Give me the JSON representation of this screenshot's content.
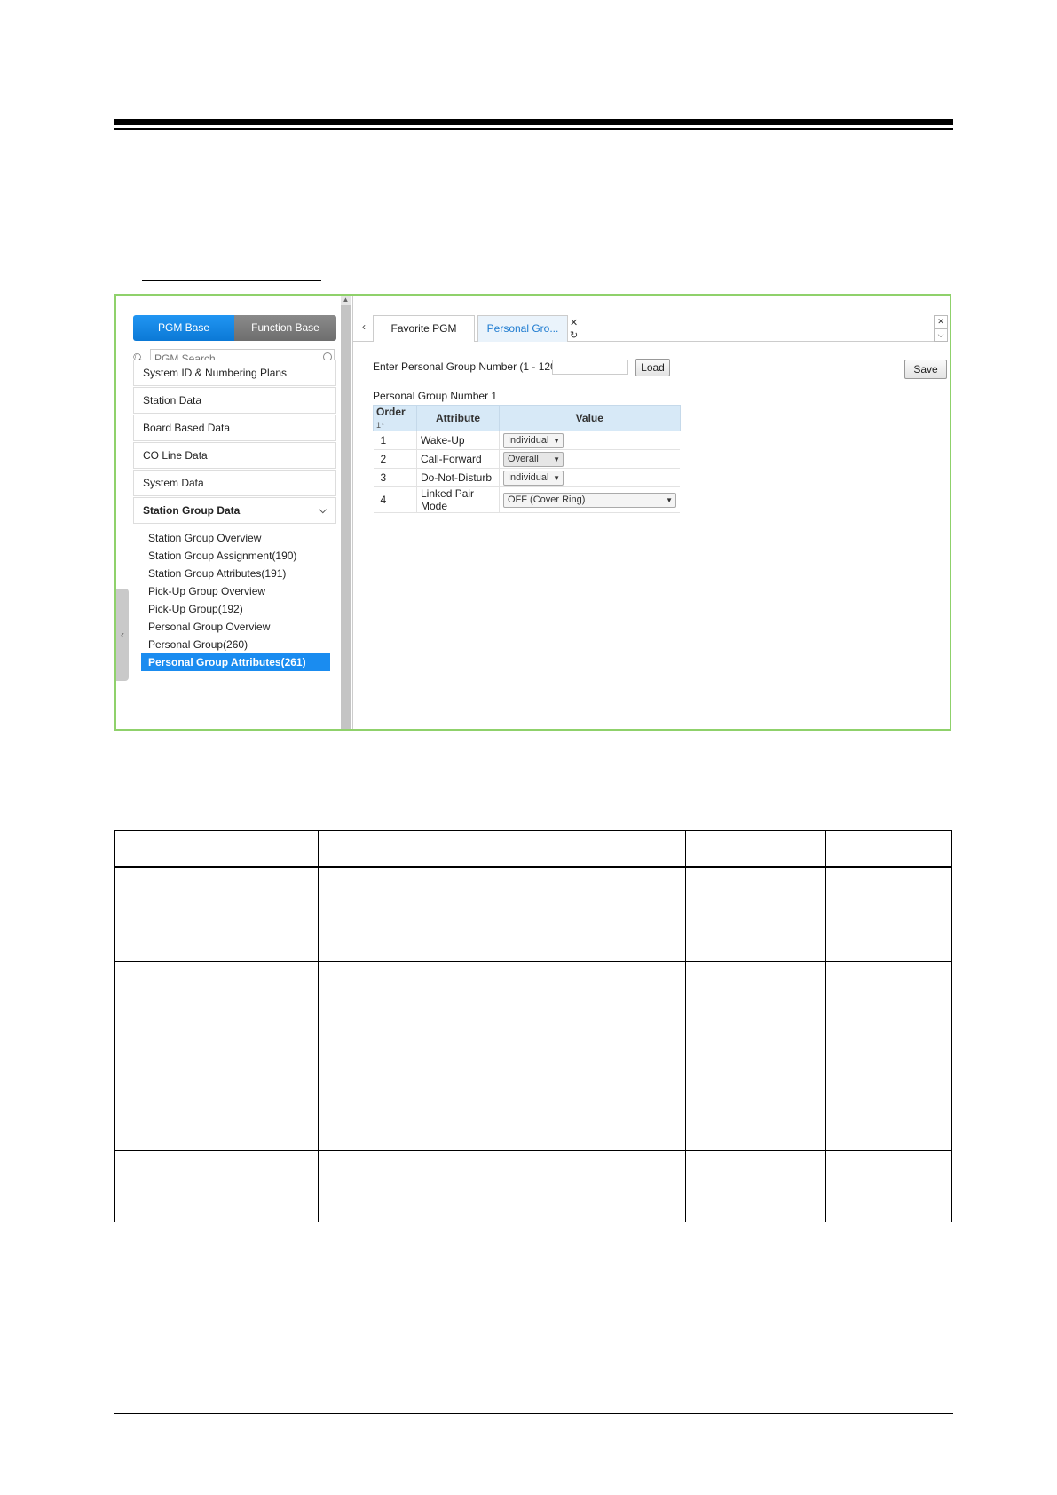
{
  "sidebar": {
    "tabs": [
      "PGM Base",
      "Function Base"
    ],
    "search_placeholder": "PGM Search",
    "items": [
      "System ID & Numbering Plans",
      "Station Data",
      "Board Based Data",
      "CO Line Data",
      "System Data",
      "Station Group Data"
    ],
    "sub_items": [
      "Station Group Overview",
      "Station Group Assignment(190)",
      "Station Group Attributes(191)",
      "Pick-Up Group Overview",
      "Pick-Up Group(192)",
      "Personal Group Overview",
      "Personal Group(260)",
      "Personal Group Attributes(261)"
    ]
  },
  "content": {
    "tabs": [
      "Favorite PGM",
      "Personal Gro..."
    ],
    "enter_label": "Enter Personal Group Number (1 - 1200) :",
    "load_label": "Load",
    "save_label": "Save",
    "group_label": "Personal Group Number 1",
    "table": {
      "headers": [
        "Order",
        "Attribute",
        "Value"
      ],
      "sort_icon": "1↑",
      "rows": [
        {
          "order": "1",
          "attribute": "Wake-Up",
          "value": "Individual"
        },
        {
          "order": "2",
          "attribute": "Call-Forward",
          "value": "Overall"
        },
        {
          "order": "3",
          "attribute": "Do-Not-Disturb",
          "value": "Individual"
        },
        {
          "order": "4",
          "attribute": "Linked Pair Mode",
          "value": "OFF (Cover Ring)"
        }
      ]
    }
  },
  "colors": {
    "accent": "#1a8cf0",
    "frame": "#8fd16b",
    "header_bg": "#d7e9f7"
  }
}
